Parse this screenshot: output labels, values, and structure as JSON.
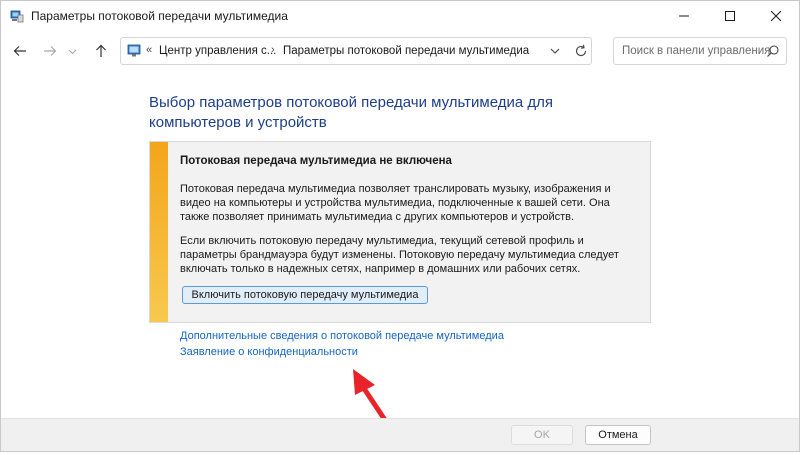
{
  "window": {
    "title": "Параметры потоковой передачи мультимедиа"
  },
  "addressbar": {
    "prefix": "«",
    "crumb_parent": "Центр управления с...",
    "separator": "›",
    "crumb_current": "Параметры потоковой передачи мультимедиа"
  },
  "search": {
    "placeholder": "Поиск в панели управления"
  },
  "main": {
    "heading": "Выбор параметров потоковой передачи мультимедиа для компьютеров и устройств",
    "panel": {
      "title": "Потоковая передача мультимедиа не включена",
      "paragraph1": "Потоковая передача мультимедиа позволяет транслировать музыку, изображения и видео на компьютеры и устройства мультимедиа, подключенные к вашей сети. Она также позволяет принимать мультимедиа с других компьютеров и устройств.",
      "paragraph2": "Если включить потоковую передачу мультимедиа, текущий сетевой профиль и параметры брандмауэра будут изменены. Потоковую передачу мультимедиа следует включать только в надежных сетях, например в домашних или рабочих сетях.",
      "enable_button": "Включить потоковую передачу мультимедиа"
    },
    "links": [
      "Дополнительные сведения о потоковой передаче мультимедиа",
      "Заявление о конфиденциальности"
    ]
  },
  "footer": {
    "ok_label": "OK",
    "ok_enabled": false,
    "cancel_label": "Отмена"
  },
  "icons": {
    "app": "media-streaming-icon",
    "back": "arrow-left-icon",
    "forward": "arrow-right-icon",
    "up": "arrow-up-icon",
    "dropdown": "chevron-down-icon",
    "refresh": "refresh-icon",
    "search": "search-icon"
  },
  "colors": {
    "heading": "#1e3e8a",
    "link": "#1565c0",
    "panel_stripe": "#f3a51b",
    "enable_button_border": "#5b9bd5",
    "annotation_arrow": "#e8232a"
  }
}
